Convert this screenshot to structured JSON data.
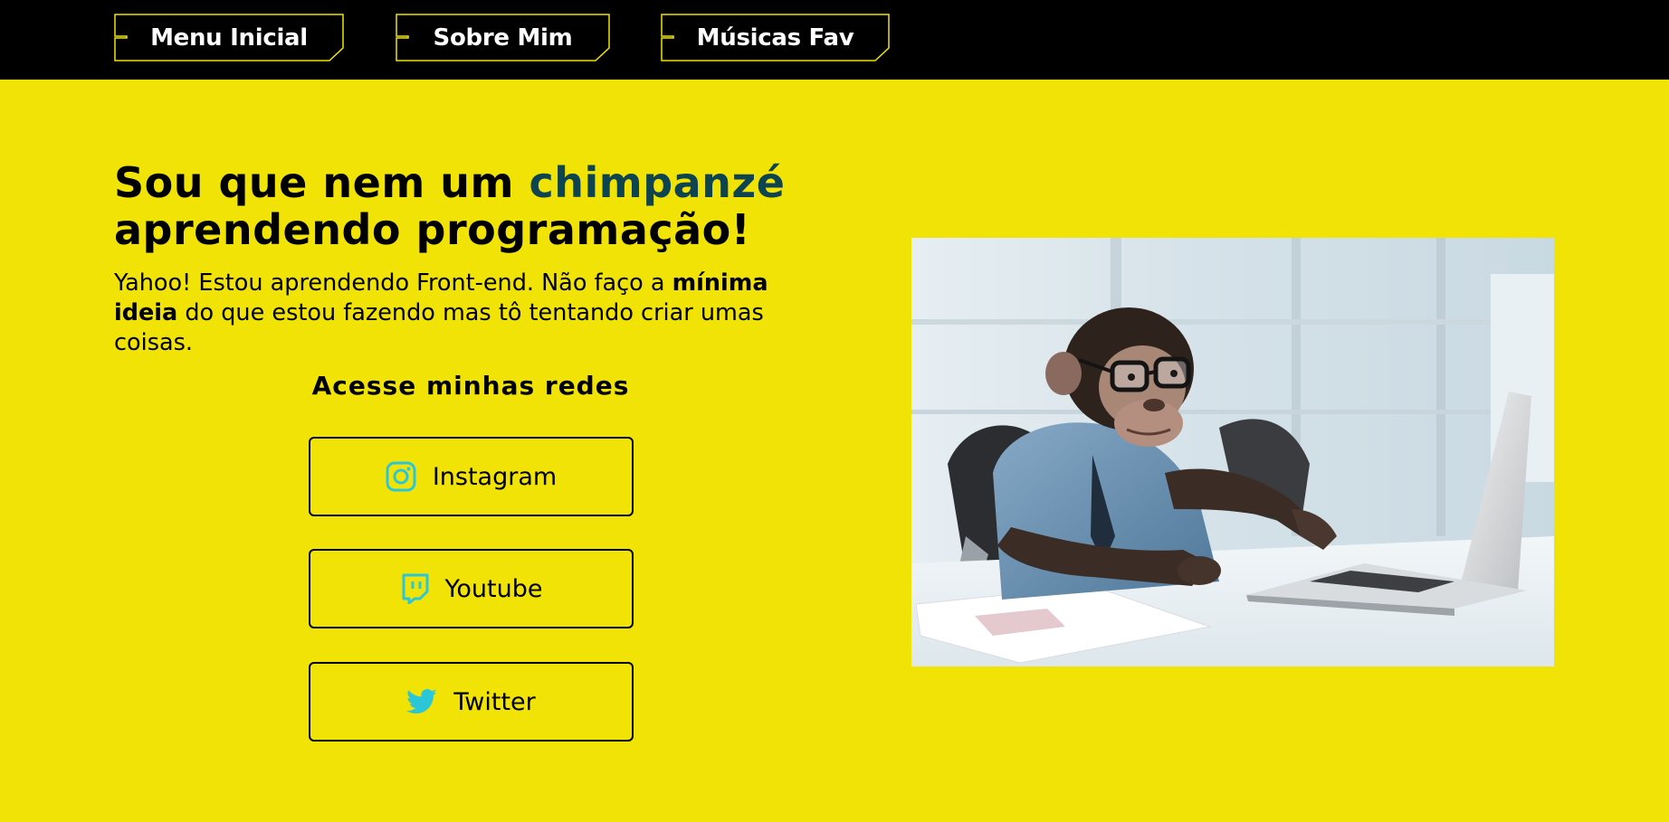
{
  "nav": {
    "items": [
      {
        "label": "Menu Inicial"
      },
      {
        "label": "Sobre Mim"
      },
      {
        "label": "Músicas Fav"
      }
    ]
  },
  "hero": {
    "title_part1": "Sou que nem um ",
    "title_accent": "chimpanzé",
    "title_part2": "aprendendo programação!",
    "desc_part1": "Yahoo! Estou aprendendo Front-end. Não faço a ",
    "desc_bold": "mínima ideia",
    "desc_part2": " do que estou fazendo mas tô tentando criar umas coisas."
  },
  "social": {
    "heading": "Acesse minhas redes",
    "buttons": [
      {
        "label": "Instagram",
        "icon": "instagram-icon"
      },
      {
        "label": "Youtube",
        "icon": "twitch-icon"
      },
      {
        "label": "Twitter",
        "icon": "twitter-icon"
      }
    ]
  },
  "photo": {
    "subject": "chimpanzee-with-glasses-at-laptop"
  },
  "colors": {
    "background": "#f1e306",
    "topbar": "#000000",
    "nav_border": "#f1e306",
    "accent_text": "#0e4350",
    "icon_cyan": "#2bc7d9"
  }
}
